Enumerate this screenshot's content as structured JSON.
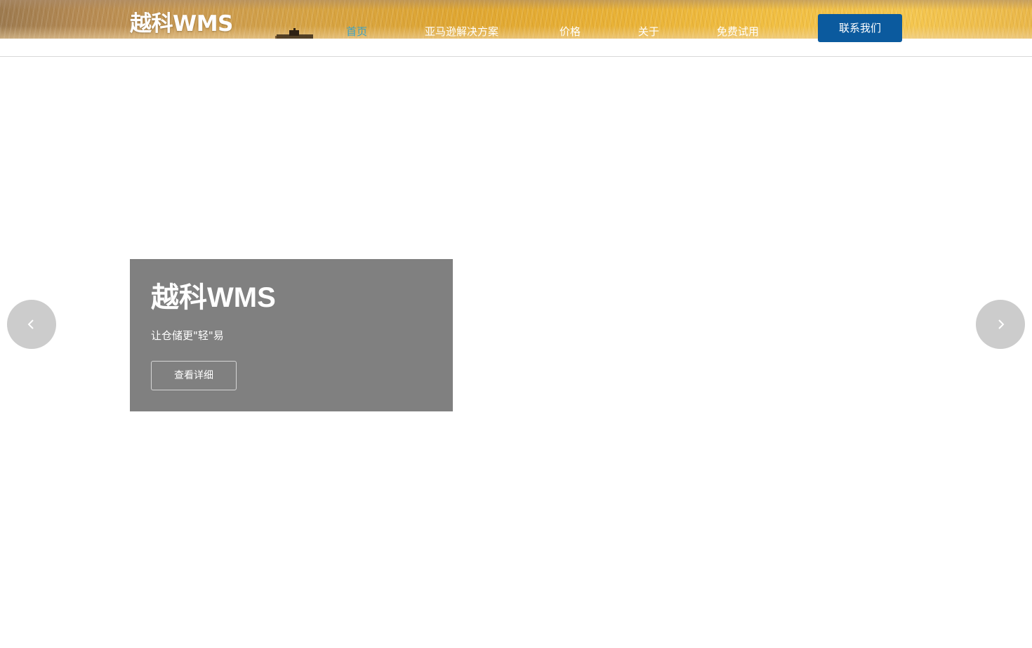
{
  "header": {
    "logo_text": "越科WMS",
    "nav": [
      {
        "label": "首页",
        "active": true
      },
      {
        "label": "亚马逊解决方案",
        "active": false
      },
      {
        "label": "价格",
        "active": false
      },
      {
        "label": "关于",
        "active": false
      },
      {
        "label": "免费试用",
        "active": false
      }
    ],
    "contact_button": "联系我们"
  },
  "hero": {
    "title": "越科WMS",
    "subtitle": "让仓储更\"轻\"易",
    "button": "查看详细"
  },
  "carousel": {
    "prev_icon": "chevron-left-icon",
    "next_icon": "chevron-right-icon"
  },
  "colors": {
    "nav_active": "#3aa0c2",
    "contact_button_bg": "#0b5a9e",
    "hero_card_bg": "#808080",
    "arrow_bg": "#cccccc"
  }
}
